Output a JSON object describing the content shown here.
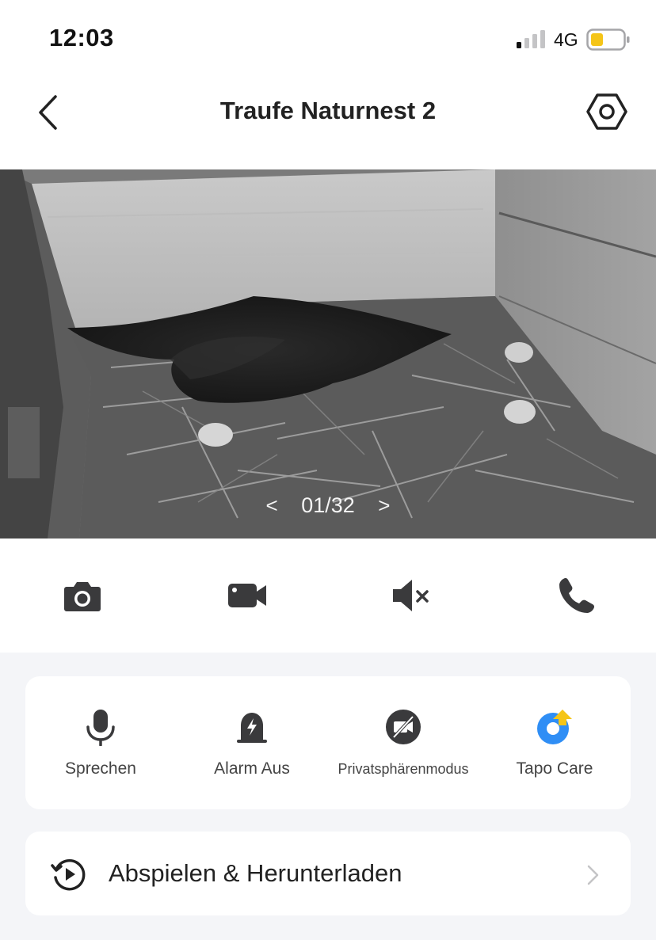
{
  "status_bar": {
    "time": "12:03",
    "network": "4G",
    "battery_color": "#f5c518"
  },
  "header": {
    "title": "Traufe Naturnest 2"
  },
  "video": {
    "counter": "01/32",
    "prev": "<",
    "next": ">"
  },
  "controls": [
    "camera-snapshot",
    "video-record",
    "sound-muted",
    "call"
  ],
  "features": [
    {
      "label": "Sprechen",
      "icon": "microphone-icon"
    },
    {
      "label": "Alarm Aus",
      "icon": "alarm-siren-icon"
    },
    {
      "label": "Privatsphärenmodus",
      "icon": "privacy-mode-icon"
    },
    {
      "label": "Tapo Care",
      "icon": "tapo-care-icon"
    }
  ],
  "playback": {
    "label": "Abspielen & Herunterladen"
  },
  "colors": {
    "icon_dark": "#3a3a3c",
    "accent_blue": "#2f8ef5",
    "accent_yellow": "#f5c518"
  }
}
